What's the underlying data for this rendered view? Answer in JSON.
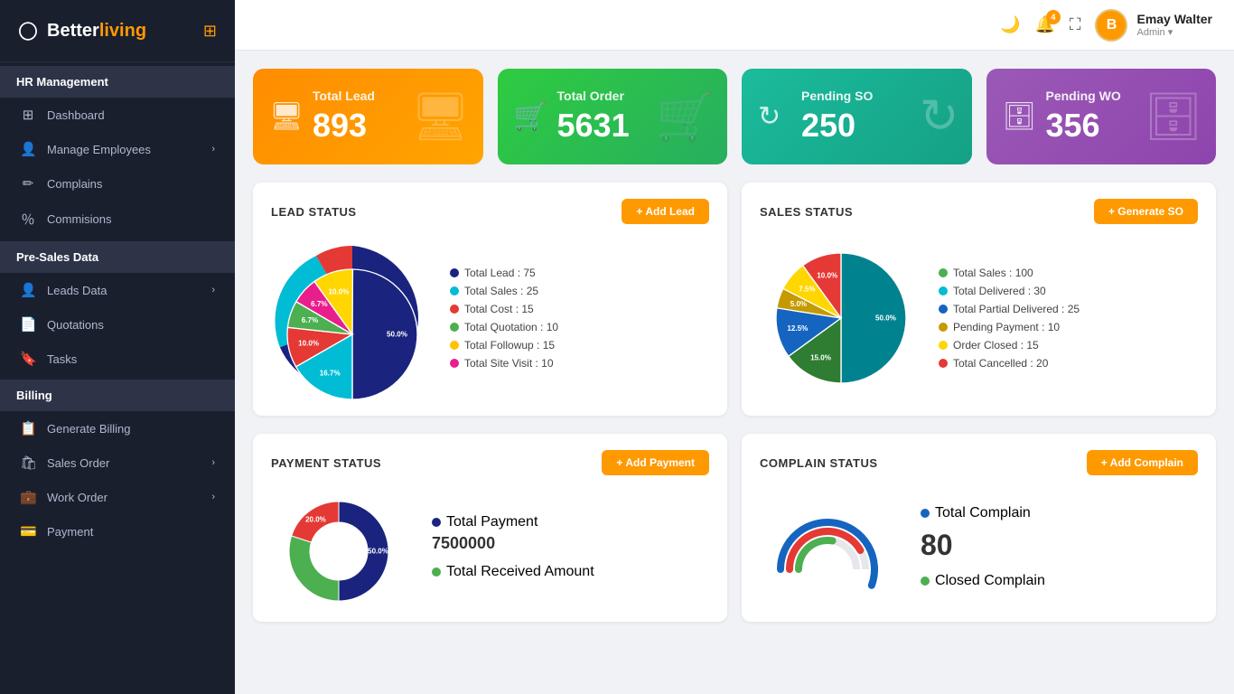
{
  "sidebar": {
    "logo": {
      "text_white": "Better",
      "text_orange": "living"
    },
    "sections": [
      {
        "header": "HR Management",
        "items": [
          {
            "label": "Dashboard",
            "icon": "⊞",
            "active": false
          },
          {
            "label": "Manage Employees",
            "icon": "👤",
            "has_chevron": true,
            "active": false
          },
          {
            "label": "Complains",
            "icon": "✏️",
            "active": false
          },
          {
            "label": "Commisions",
            "icon": "📊",
            "active": false
          }
        ]
      },
      {
        "header": "Pre-Sales Data",
        "items": [
          {
            "label": "Leads Data",
            "icon": "👤",
            "has_chevron": true,
            "active": false
          },
          {
            "label": "Quotations",
            "icon": "📄",
            "active": false
          },
          {
            "label": "Tasks",
            "icon": "🔖",
            "active": false
          }
        ]
      },
      {
        "header": "Billing",
        "items": [
          {
            "label": "Generate Billing",
            "icon": "📋",
            "active": false
          },
          {
            "label": "Sales Order",
            "icon": "🛍️",
            "has_chevron": true,
            "active": false
          },
          {
            "label": "Work Order",
            "icon": "💼",
            "has_chevron": true,
            "active": false
          },
          {
            "label": "Payment",
            "icon": "💳",
            "active": false
          }
        ]
      }
    ]
  },
  "topbar": {
    "notification_count": "4",
    "user_initial": "B",
    "user_name": "Emay Walter",
    "user_role": "Admin"
  },
  "stats": [
    {
      "label": "Total Lead",
      "value": "893",
      "color": "orange"
    },
    {
      "label": "Total Order",
      "value": "5631",
      "color": "green"
    },
    {
      "label": "Pending SO",
      "value": "250",
      "color": "teal"
    },
    {
      "label": "Pending WO",
      "value": "356",
      "color": "purple"
    }
  ],
  "lead_status": {
    "title": "LEAD STATUS",
    "button": "+ Add Lead",
    "legend": [
      {
        "label": "Total Lead : 75",
        "color": "#1a237e"
      },
      {
        "label": "Total Sales : 25",
        "color": "#00bcd4"
      },
      {
        "label": "Total Cost : 15",
        "color": "#e53935"
      },
      {
        "label": "Total Quotation : 10",
        "color": "#4caf50"
      },
      {
        "label": "Total Followup : 15",
        "color": "#ffc107"
      },
      {
        "label": "Total Site Visit : 10",
        "color": "#e91e8c"
      }
    ],
    "slices": [
      {
        "percent": 50.0,
        "color": "#1a237e",
        "label": "50.0%"
      },
      {
        "percent": 16.7,
        "color": "#00bcd4",
        "label": "16.7%"
      },
      {
        "percent": 10.0,
        "color": "#e53935",
        "label": "10.0%"
      },
      {
        "percent": 6.7,
        "color": "#4caf50",
        "label": "6.7%"
      },
      {
        "percent": 6.7,
        "color": "#e91e8c",
        "label": "6.7%"
      },
      {
        "percent": 10.0,
        "color": "#ffd600",
        "label": "10.0%"
      }
    ]
  },
  "sales_status": {
    "title": "SALES STATUS",
    "button": "+ Generate SO",
    "legend": [
      {
        "label": "Total Sales : 100",
        "color": "#4caf50"
      },
      {
        "label": "Total Delivered : 30",
        "color": "#00bcd4"
      },
      {
        "label": "Total Partial Delivered : 25",
        "color": "#1565c0"
      },
      {
        "label": "Pending Payment : 10",
        "color": "#c49a00"
      },
      {
        "label": "Order Closed : 15",
        "color": "#ffd600"
      },
      {
        "label": "Total Cancelled : 20",
        "color": "#e53935"
      }
    ],
    "slices": [
      {
        "percent": 50.0,
        "color": "#00838f",
        "label": "50.0%"
      },
      {
        "percent": 15.0,
        "color": "#2e7d32",
        "label": "15.0%"
      },
      {
        "percent": 12.5,
        "color": "#1565c0",
        "label": "12.5%"
      },
      {
        "percent": 5.0,
        "color": "#c49a00",
        "label": "5.0%"
      },
      {
        "percent": 7.5,
        "color": "#ffd600",
        "label": "7.5%"
      },
      {
        "percent": 10.0,
        "color": "#e53935",
        "label": "10.0%"
      }
    ]
  },
  "payment_status": {
    "title": "PAYMENT STATUS",
    "button": "+ Add Payment",
    "total_payment_label": "Total Payment",
    "total_payment_value": "7500000",
    "total_received_label": "Total Received Amount",
    "dot_color1": "#1a237e",
    "dot_color2": "#4caf50",
    "slices": [
      {
        "percent": 50.0,
        "color": "#1a237e"
      },
      {
        "percent": 30.0,
        "color": "#4caf50"
      },
      {
        "percent": 20.0,
        "color": "#e53935",
        "label": "20.0%"
      }
    ]
  },
  "complain_status": {
    "title": "COMPLAIN STATUS",
    "button": "+ Add Complain",
    "total_complain_label": "Total Complain",
    "total_complain_value": "80",
    "closed_complain_label": "Closed Complain"
  }
}
